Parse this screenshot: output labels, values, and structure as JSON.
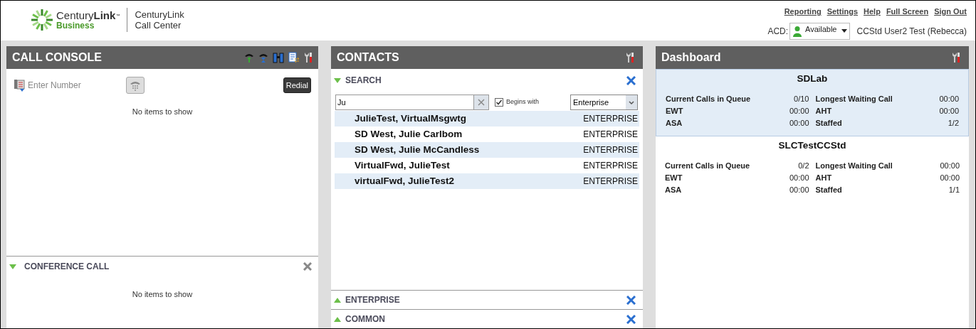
{
  "header": {
    "brand": {
      "name_light": "Century",
      "name_bold": "Link",
      "tm": "™",
      "sub": "Business"
    },
    "product": [
      "CenturyLink",
      "Call Center"
    ],
    "links": [
      "Reporting",
      "Settings",
      "Help",
      "Full Screen",
      "Sign Out"
    ],
    "acd": {
      "label": "ACD:",
      "status": "Available"
    },
    "user": "CCStd User2 Test (Rebecca)"
  },
  "call_console": {
    "title": "CALL CONSOLE",
    "number_placeholder": "Enter Number",
    "redial": "Redial",
    "empty": "No items to show",
    "conference": {
      "title": "CONFERENCE CALL",
      "expanded": true,
      "empty": "No items to show"
    }
  },
  "contacts": {
    "title": "CONTACTS",
    "search": {
      "title": "SEARCH",
      "expanded": true,
      "query": "Ju",
      "begins_with": {
        "label": "Begins with",
        "checked": true
      },
      "directory": "Enterprise"
    },
    "results": [
      {
        "name": "JulieTest, VirtualMsgwtg",
        "type": "ENTERPRISE"
      },
      {
        "name": "SD West, Julie Carlbom",
        "type": "ENTERPRISE"
      },
      {
        "name": "SD West, Julie McCandless",
        "type": "ENTERPRISE"
      },
      {
        "name": "VirtualFwd, JulieTest",
        "type": "ENTERPRISE"
      },
      {
        "name": "virtualFwd, JulieTest2",
        "type": "ENTERPRISE"
      }
    ],
    "sections": [
      {
        "title": "ENTERPRISE",
        "expanded": false
      },
      {
        "title": "COMMON",
        "expanded": false
      }
    ]
  },
  "dashboard": {
    "title": "Dashboard",
    "queues": [
      {
        "name": "SDLab",
        "stats": [
          [
            "Current Calls in Queue",
            "0/10"
          ],
          [
            "Longest Waiting Call",
            "00:00"
          ],
          [
            "EWT",
            "00:00"
          ],
          [
            "AHT",
            "00:00"
          ],
          [
            "ASA",
            "00:00"
          ],
          [
            "Staffed",
            "1/2"
          ]
        ]
      },
      {
        "name": "SLCTestCCStd",
        "stats": [
          [
            "Current Calls in Queue",
            "0/2"
          ],
          [
            "Longest Waiting Call",
            "00:00"
          ],
          [
            "EWT",
            "00:00"
          ],
          [
            "AHT",
            "00:00"
          ],
          [
            "ASA",
            "00:00"
          ],
          [
            "Staffed",
            "1/1"
          ]
        ]
      }
    ]
  }
}
